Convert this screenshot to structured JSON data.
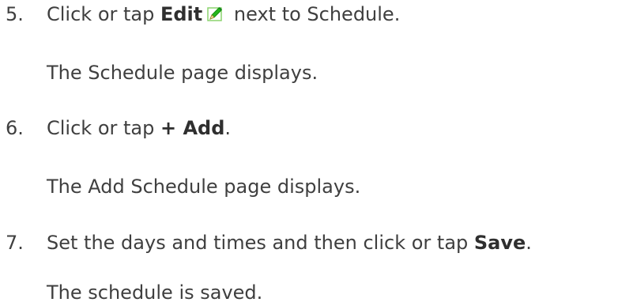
{
  "steps": [
    {
      "number": "5.",
      "prefix": "Click or tap ",
      "bold": "Edit",
      "icon": "edit-pencil-icon",
      "suffix": " next to Schedule.",
      "result": "The Schedule page displays."
    },
    {
      "number": "6.",
      "prefix": "Click or tap ",
      "bold": "+ Add",
      "suffix": ".",
      "result": "The Add Schedule page displays."
    },
    {
      "number": "7.",
      "prefix": "Set the days and times and then click or tap ",
      "bold": "Save",
      "suffix": ".",
      "result": "The schedule is saved."
    }
  ]
}
